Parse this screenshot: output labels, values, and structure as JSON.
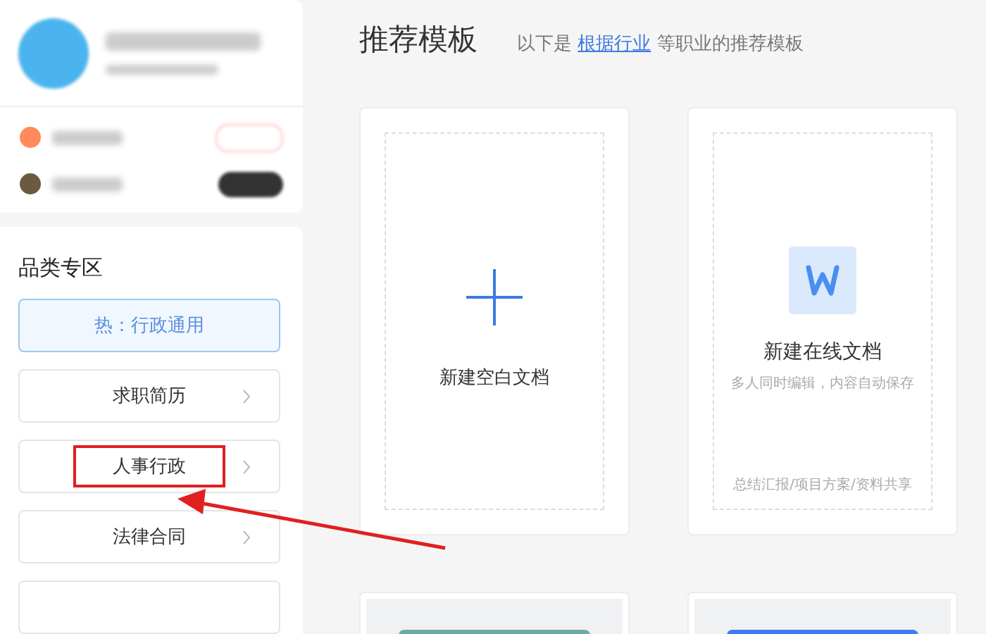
{
  "profile": {
    "membership_rows": [
      {
        "color": "#ff8a5c"
      },
      {
        "color": "#6b5a3e"
      }
    ]
  },
  "category_panel": {
    "title": "品类专区",
    "items": [
      {
        "label": "热：行政通用",
        "kind": "hot",
        "selected": true,
        "highlighted": false
      },
      {
        "label": "求职简历",
        "kind": "normal",
        "selected": false,
        "highlighted": false
      },
      {
        "label": "人事行政",
        "kind": "normal",
        "selected": false,
        "highlighted": true
      },
      {
        "label": "法律合同",
        "kind": "normal",
        "selected": false,
        "highlighted": false
      },
      {
        "kind": "normal",
        "selected": false,
        "highlighted": false
      }
    ]
  },
  "main": {
    "title": "推荐模板",
    "subtitle_before": "以下是",
    "subtitle_link": "根据行业",
    "subtitle_after": "等职业的推荐模板",
    "cards": [
      {
        "kind": "blank",
        "title": "新建空白文档"
      },
      {
        "kind": "online",
        "title": "新建在线文档",
        "description": "多人同时编辑，内容自动保存",
        "tags": "总结汇报/项目方案/资料共享"
      }
    ]
  }
}
